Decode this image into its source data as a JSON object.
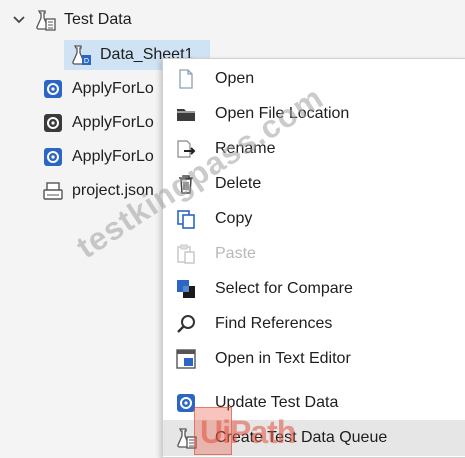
{
  "tree": {
    "root": {
      "label": "Test Data",
      "icon": "test-data-icon"
    },
    "items": [
      {
        "label": "Data_Sheet1",
        "icon": "test-data-file-icon",
        "selected": true
      },
      {
        "label": "ApplyForLo",
        "icon": "workflow-file-icon"
      },
      {
        "label": "ApplyForLo",
        "icon": "workflow-file-icon"
      },
      {
        "label": "ApplyForLo",
        "icon": "workflow-file-icon"
      },
      {
        "label": "project.json",
        "icon": "json-file-icon"
      }
    ]
  },
  "context_menu": {
    "items": [
      {
        "label": "Open",
        "icon": "blank-file-icon"
      },
      {
        "label": "Open File Location",
        "icon": "folder-icon"
      },
      {
        "label": "Rename",
        "icon": "rename-icon"
      },
      {
        "label": "Delete",
        "icon": "trash-icon"
      },
      {
        "label": "Copy",
        "icon": "copy-icon"
      },
      {
        "label": "Paste",
        "icon": "paste-icon",
        "disabled": true
      },
      {
        "label": "Select for Compare",
        "icon": "compare-icon"
      },
      {
        "label": "Find References",
        "icon": "magnifier-icon"
      },
      {
        "label": "Open in Text Editor",
        "icon": "text-editor-icon"
      },
      {
        "label": "Update Test Data",
        "icon": "update-icon"
      },
      {
        "label": "Create Test Data Queue",
        "icon": "test-data-queue-icon",
        "hovered": true
      }
    ]
  },
  "watermark": "testkingpass.com",
  "logo": "UiPath",
  "colors": {
    "accent": "#2b66c4",
    "selection": "#cfe3f5",
    "hover": "#e6e6e6"
  }
}
